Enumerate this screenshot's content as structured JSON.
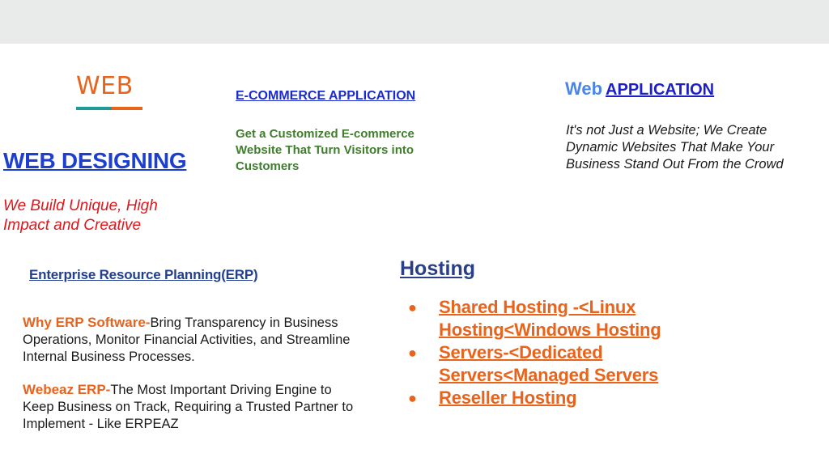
{
  "web_logo": {
    "text": "WEB",
    "colors": {
      "text": "#e8631c",
      "bar_left": "#1e9c94",
      "bar_right": "#e8631c"
    }
  },
  "web_designing": {
    "title": "WEB DESIGNING",
    "tagline": "We Build Unique, High Impact and Creative"
  },
  "ecommerce": {
    "title": "E-COMMERCE APPLICATION",
    "description": "Get a Customized E-commerce Website That Turn Visitors into Customers"
  },
  "web_application": {
    "title_part1": "Web",
    "title_part2": "APPLICATION",
    "description": "It's not Just a Website; We Create Dynamic Websites That Make Your Business Stand Out From the Crowd"
  },
  "erp": {
    "title": "Enterprise Resource Planning(ERP)",
    "p1_lead": "Why ERP Software-",
    "p1_text": "Bring Transparency in Business Operations, Monitor Financial Activities, and Streamline Internal Business Processes.",
    "p2_lead": "Webeaz ERP-",
    "p2_text": "The Most Important Driving Engine to Keep Business on Track, Requiring a Trusted Partner to Implement - Like ERPEAZ"
  },
  "hosting": {
    "title": "Hosting",
    "items": [
      {
        "bullet": "●",
        "label": "Shared Hosting  -<Linux Hosting<Windows Hosting"
      },
      {
        "bullet": "●",
        "label": "Servers-<Dedicated Servers<Managed Servers"
      },
      {
        "bullet": "●",
        "label": "Reseller Hosting"
      }
    ]
  }
}
